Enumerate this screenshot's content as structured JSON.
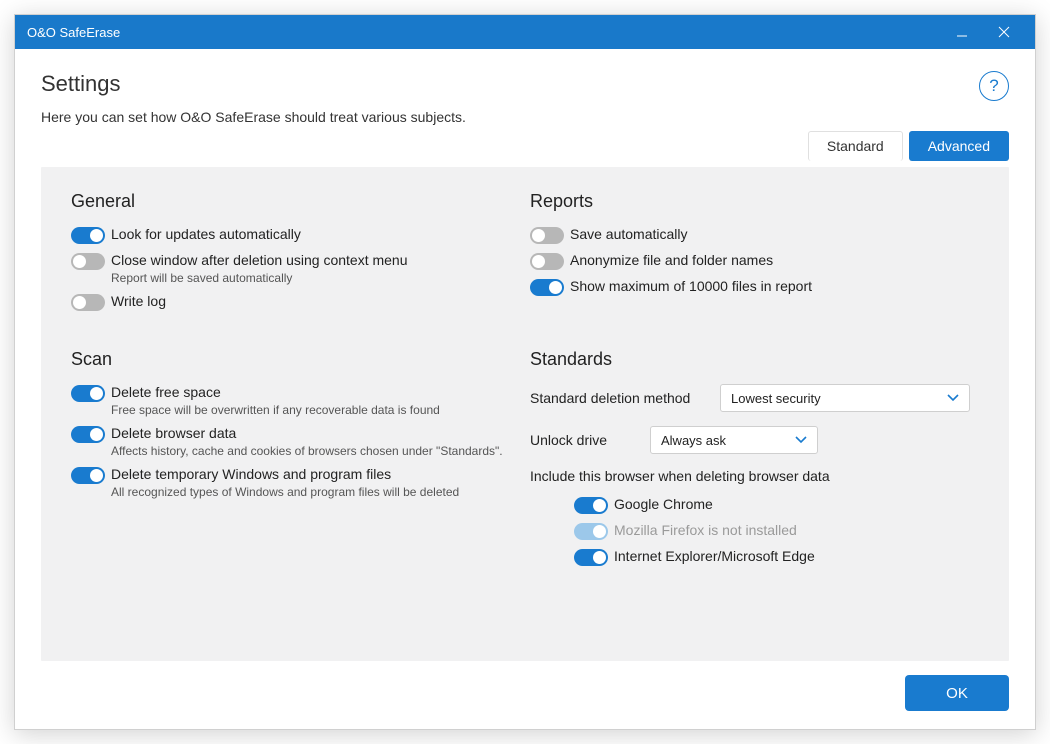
{
  "titlebar": {
    "title": "O&O SafeErase"
  },
  "header": {
    "title": "Settings",
    "subtitle": "Here you can set how O&O SafeErase should treat various subjects.",
    "help": "?"
  },
  "tabs": {
    "standard": "Standard",
    "advanced": "Advanced"
  },
  "general": {
    "title": "General",
    "updates": "Look for updates automatically",
    "close_window": "Close window after deletion using context menu",
    "close_window_sub": "Report will be saved automatically",
    "write_log": "Write log"
  },
  "reports": {
    "title": "Reports",
    "save_auto": "Save automatically",
    "anonymize": "Anonymize file and folder names",
    "max_files": "Show maximum of 10000 files in report"
  },
  "scan": {
    "title": "Scan",
    "free_space": "Delete free space",
    "free_space_sub": "Free space will be overwritten if any recoverable data is found",
    "browser_data": "Delete browser data",
    "browser_data_sub": "Affects history, cache and cookies of browsers chosen under \"Standards\".",
    "temp_files": "Delete temporary Windows and program files",
    "temp_files_sub": "All recognized types of Windows and program files will be deleted"
  },
  "standards": {
    "title": "Standards",
    "method_label": "Standard deletion method",
    "method_value": "Lowest security",
    "unlock_label": "Unlock drive",
    "unlock_value": "Always ask",
    "include_label": "Include this browser when deleting browser data",
    "chrome": "Google Chrome",
    "firefox": "Mozilla Firefox is not installed",
    "edge": "Internet Explorer/Microsoft Edge"
  },
  "footer": {
    "ok": "OK"
  }
}
